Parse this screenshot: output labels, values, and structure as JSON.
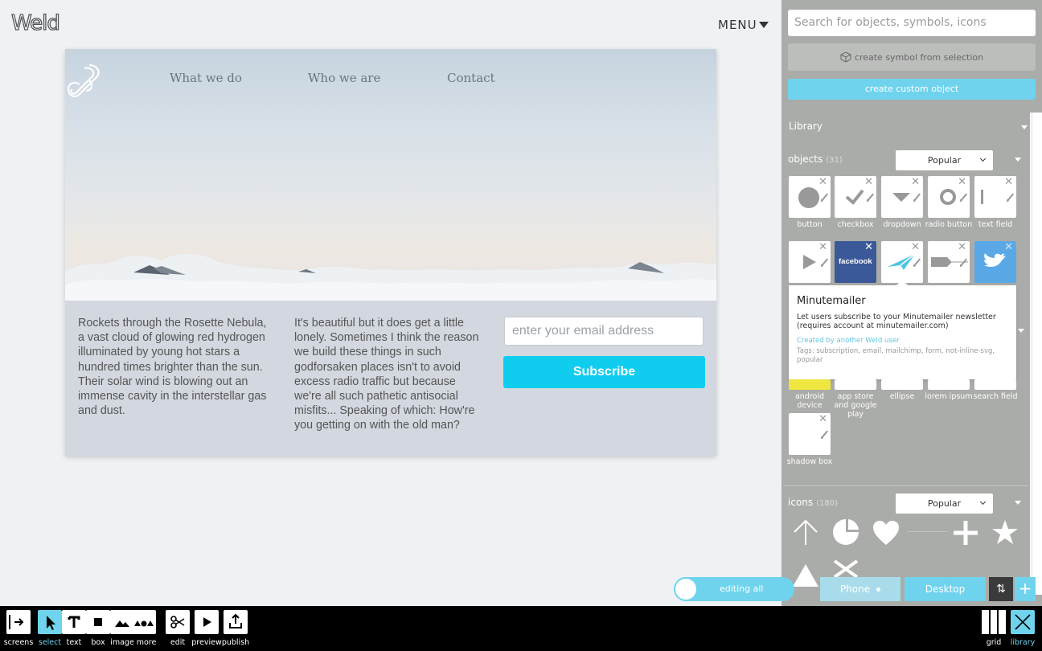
{
  "app": {
    "logo": "Weld",
    "menu_label": "MENU"
  },
  "site": {
    "nav": [
      "What we do",
      "Who we are",
      "Contact"
    ],
    "col1": "Rockets through the Rosette Nebula, a vast cloud of glowing red hydrogen illuminated by young hot stars a hundred times brighter than the sun. Their solar wind is blowing out an immense cavity in the interstellar gas and dust.",
    "col2": "It's beautiful but it does get a little lonely. Sometimes I think the reason we build these things in such godforsaken places isn't to avoid excess radio traffic but because we're all such pathetic antisocial misfits... Speaking of which: How're you getting on with the old man?",
    "email_placeholder": "enter your email address",
    "subscribe_label": "Subscribe"
  },
  "panel": {
    "search_placeholder": "Search for objects, symbols, icons",
    "create_symbol_label": "create symbol from selection",
    "create_custom_label": "create custom object",
    "library_label": "Library",
    "objects": {
      "label": "objects",
      "count": "(31)",
      "sort": "Popular",
      "row1": [
        "button",
        "checkbox",
        "dropdown",
        "radio button",
        "text field"
      ],
      "row3": [
        "android device",
        "app store and google play",
        "ellipse",
        "lorem ipsum",
        "search field"
      ],
      "row4": [
        "shadow box"
      ]
    },
    "tooltip": {
      "title": "Minutemailer",
      "description": "Let users subscribe to your Minutemailer newsletter (requires account at minutemailer.com)",
      "creator": "Created by another Weld user",
      "tags": "Tags: subscription, email, mailchimp, form, not-inline-svg, popular"
    },
    "facebook_label": "facebook",
    "icons": {
      "label": "icons",
      "count": "(180)",
      "sort": "Popular"
    }
  },
  "modes": {
    "editing_label": "editing all",
    "phone_label": "Phone",
    "desktop_label": "Desktop"
  },
  "toolbar": {
    "items": [
      "screens",
      "select",
      "text",
      "box",
      "image",
      "more",
      "edit",
      "preview",
      "publish",
      "grid",
      "library"
    ]
  },
  "colors": {
    "accent": "#6fd3ed",
    "subscribe": "#10cdef",
    "panel": "#aaaca9",
    "facebook": "#3b5998",
    "twitter": "#5aa9e6",
    "android": "#f0e640"
  }
}
